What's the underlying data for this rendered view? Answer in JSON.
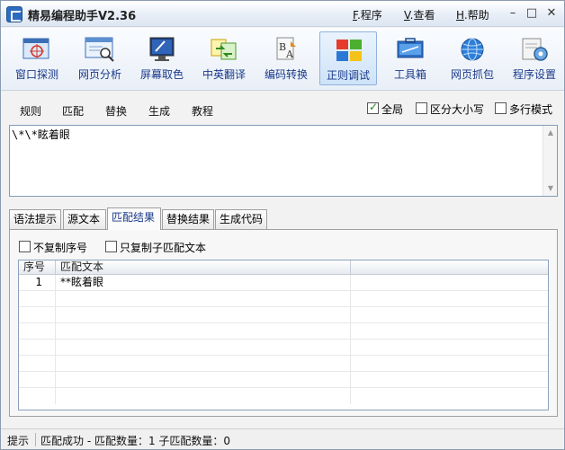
{
  "window": {
    "title": "精易编程助手V2.36",
    "menus": [
      {
        "key": "F",
        "label": ".程序"
      },
      {
        "key": "V",
        "label": ".查看"
      },
      {
        "key": "H",
        "label": ".帮助"
      }
    ],
    "controls": {
      "minimize": "–",
      "restore": "□",
      "close": "✕"
    }
  },
  "toolbar": {
    "items": [
      {
        "label": "窗口探测",
        "icon": "window-detect-icon"
      },
      {
        "label": "网页分析",
        "icon": "webpage-analysis-icon"
      },
      {
        "label": "屏幕取色",
        "icon": "color-picker-icon"
      },
      {
        "label": "中英翻译",
        "icon": "translate-icon"
      },
      {
        "label": "编码转换",
        "icon": "encoding-icon"
      },
      {
        "label": "正则调试",
        "icon": "regex-debug-icon",
        "active": true
      },
      {
        "label": "工具箱",
        "icon": "toolbox-icon"
      },
      {
        "label": "网页抓包",
        "icon": "packet-capture-icon"
      },
      {
        "label": "程序设置",
        "icon": "settings-icon"
      }
    ]
  },
  "options": {
    "tabs": [
      "规则",
      "匹配",
      "替换",
      "生成",
      "教程"
    ],
    "checks": [
      {
        "label": "全局",
        "checked": true
      },
      {
        "label": "区分大小写",
        "checked": false
      },
      {
        "label": "多行模式",
        "checked": false
      }
    ]
  },
  "regex": {
    "value": "\\*\\*眩着眼"
  },
  "tabs": {
    "items": [
      "语法提示",
      "源文本",
      "匹配结果",
      "替换结果",
      "生成代码"
    ],
    "active": "匹配结果"
  },
  "panel": {
    "checks": [
      {
        "label": "不复制序号",
        "checked": false
      },
      {
        "label": "只复制子匹配文本",
        "checked": false
      }
    ],
    "columns": [
      "序号",
      "匹配文本",
      ""
    ],
    "rows": [
      {
        "index": "1",
        "text": "**眩着眼"
      }
    ]
  },
  "status": {
    "label": "提示",
    "message": "匹配成功 - 匹配数量：1  子匹配数量：0"
  }
}
